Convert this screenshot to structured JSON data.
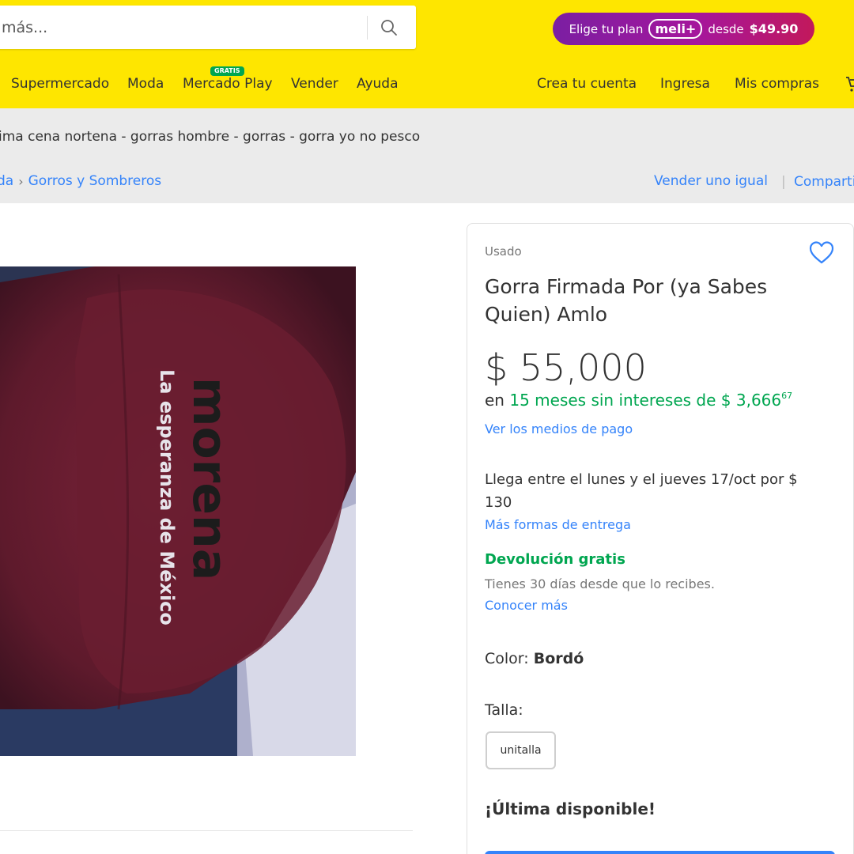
{
  "header": {
    "search": {
      "placeholder": "más...",
      "value": ""
    },
    "promo": {
      "prefix": "Elige tu plan",
      "brand": "meli+",
      "middle": "desde",
      "price": "$49.90"
    },
    "nav_left": [
      "Supermercado",
      "Moda",
      "Mercado Play",
      "Vender",
      "Ayuda"
    ],
    "badge_gratis": "GRATIS",
    "nav_right": [
      "Crea tu cuenta",
      "Ingresa",
      "Mis compras"
    ]
  },
  "related_searches": "ima cena nortena - gorras hombre - gorras - gorra yo no pesco",
  "breadcrumb": [
    "da",
    "Gorros y Sombreros"
  ],
  "actions": {
    "sell_same": "Vender uno igual",
    "share": "Comparti"
  },
  "photo": {
    "cap_text": "morena",
    "cap_subtext": "La esperanza de México"
  },
  "product": {
    "condition": "Usado",
    "title": "Gorra Firmada Por (ya Sabes Quien) Amlo",
    "price": "$ 55,000",
    "installments_prefix": "en",
    "installments_green": "15 meses sin intereses de $ 3,666",
    "installments_cents": "67",
    "payment_link": "Ver los medios de pago",
    "delivery": "Llega entre el lunes y el jueves 17/oct por $ 130",
    "delivery_link": "Más formas de entrega",
    "returns_title": "Devolución gratis",
    "returns_sub": "Tienes 30 días desde que lo recibes.",
    "returns_link": "Conocer más",
    "color_label": "Color:",
    "color_value": "Bordó",
    "size_label": "Talla:",
    "size_option": "unitalla",
    "stock_note": "¡Última disponible!"
  },
  "colors": {
    "header_yellow": "#fee600",
    "link_blue": "#3483fa",
    "green": "#00a650",
    "cap_maroon": "#6d1e33"
  }
}
